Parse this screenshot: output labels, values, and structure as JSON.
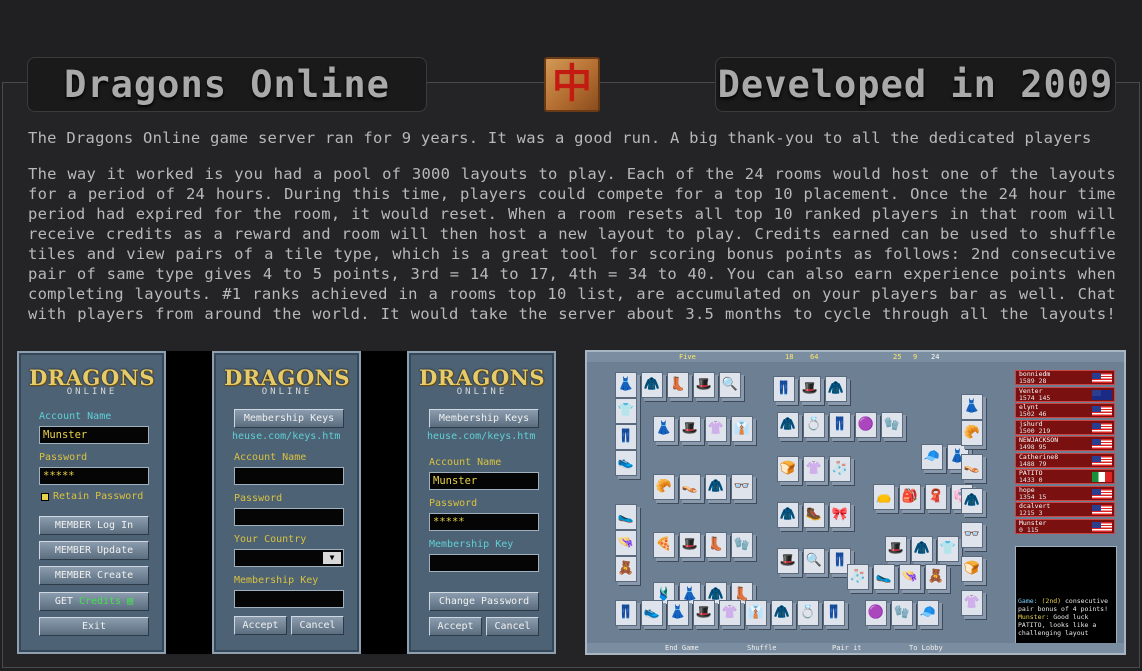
{
  "header": {
    "left_title": "Dragons Online",
    "right_title": "Developed in 2009",
    "logo_glyph": "中"
  },
  "intro": "The Dragons Online game server ran for 9 years. It was a good run. A big thank-you to all the dedicated players",
  "description": "The way it worked is you had a pool of 3000 layouts to play. Each of the 24 rooms would host one of the layouts for a period of 24 hours. During this time, players could compete for a top 10 placement. Once the 24 hour time period had expired for the room, it would reset. When a room resets all top 10 ranked players in that room will receive credits as a reward and room will then host a new layout to play. Credits earned can be used to shuffle tiles and view pairs of a tile type, which is a great tool for scoring bonus points as follows: 2nd consecutive pair of same type gives 4 to 5 points, 3rd = 14 to 17, 4th = 34 to 40. You can also earn experience points when completing layouts. #1 ranks achieved in a rooms top 10 list, are accumulated on your players bar as well. Chat with players from around the world. It would take the server about 3.5 months to cycle through all the layouts!",
  "logo": {
    "big": "DRAGONS",
    "small": "ONLINE"
  },
  "login_panel": {
    "account_label": "Account Name",
    "account_value": "Munster",
    "password_label": "Password",
    "password_value": "*****",
    "retain_label": "Retain Password",
    "buttons": [
      "MEMBER Log In",
      "MEMBER Update",
      "MEMBER Create"
    ],
    "credits_prefix": "GET",
    "credits_word": "Credits",
    "exit": "Exit"
  },
  "create_panel": {
    "keys_button": "Membership Keys",
    "url": "heuse.com/keys.htm",
    "account_label": "Account Name",
    "password_label": "Password",
    "country_label": "Your Country",
    "key_label": "Membership Key",
    "accept": "Accept",
    "cancel": "Cancel"
  },
  "update_panel": {
    "keys_button": "Membership Keys",
    "url": "heuse.com/keys.htm",
    "account_label": "Account Name",
    "account_value": "Munster",
    "password_label": "Password",
    "password_value": "*****",
    "key_label": "Membership Key",
    "change_password": "Change Password",
    "accept": "Accept",
    "cancel": "Cancel"
  },
  "game": {
    "room": "Five",
    "top_stats": [
      "18",
      "64",
      "25",
      "9",
      "24"
    ],
    "bottom_buttons": [
      "End Game",
      "Shuffle",
      "Pair it",
      "To Lobby"
    ],
    "players": [
      {
        "name": "bonniedm",
        "stats": "1589 28",
        "flag": "us"
      },
      {
        "name": "Venter",
        "stats": "1574 145",
        "flag": "au"
      },
      {
        "name": "elynt",
        "stats": "1502 46",
        "flag": "us"
      },
      {
        "name": "jshurd",
        "stats": "1500 219",
        "flag": "us"
      },
      {
        "name": "NEWJACKSON",
        "stats": "1498 95",
        "flag": "us"
      },
      {
        "name": "Catherine8",
        "stats": "1488 79",
        "flag": "us"
      },
      {
        "name": "PATITO",
        "stats": "1433 0",
        "flag": "mx"
      },
      {
        "name": "hope",
        "stats": "1354 15",
        "flag": "us"
      },
      {
        "name": "dcalvert",
        "stats": "1215 3",
        "flag": "us"
      },
      {
        "name": "Munster",
        "stats": "0 115",
        "flag": "us"
      }
    ],
    "chat": {
      "game_prefix": "Game:",
      "game_note": "(2nd)",
      "game_text": "consecutive pair bonus of 4 points!",
      "user": "Munster:",
      "message": "Good luck PATITO, looks like a challenging layout"
    },
    "tile_glyphs": [
      "👗",
      "🧥",
      "👢",
      "🎩",
      "🔍",
      "👖",
      "🎩",
      "🧥",
      "👕",
      "👖",
      "👟",
      "👗",
      "🎩",
      "👚",
      "👔",
      "🧥",
      "💍",
      "👖",
      "🟣",
      "🧤",
      "🧢",
      "👗",
      "🥐",
      "👡",
      "🧥",
      "👓",
      "🍞",
      "👚",
      "🧦",
      "🥿",
      "👒",
      "🧸",
      "🍕",
      "🎩",
      "👢",
      "🧤",
      "🧥",
      "🥾",
      "🎀",
      "👝",
      "🎒",
      "🧣",
      "👘",
      "🩱"
    ]
  }
}
